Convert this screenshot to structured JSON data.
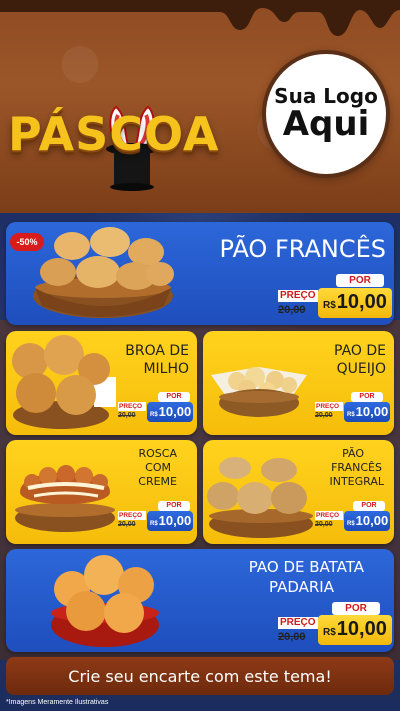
{
  "header": {
    "title": "PÁSCOA",
    "logo_line1": "Sua Logo",
    "logo_line2": "Aqui"
  },
  "products": [
    {
      "name": "PÃO FRANCÊS",
      "discount": "-50%",
      "price_label": "PREÇO",
      "old_price": "20,00",
      "por_label": "POR",
      "currency": "R$",
      "new_price": "10,00"
    },
    {
      "name_line1": "BROA DE",
      "name_line2": "MILHO",
      "price_label": "PREÇO",
      "old_price": "20,00",
      "por_label": "POR",
      "currency": "R$",
      "new_price": "10,00"
    },
    {
      "name_line1": "PAO DE",
      "name_line2": "QUEIJO",
      "price_label": "PREÇO",
      "old_price": "20,00",
      "por_label": "POR",
      "currency": "R$",
      "new_price": "10,00"
    },
    {
      "name_line1": "ROSCA",
      "name_line2": "COM",
      "name_line3": "CREME",
      "price_label": "PREÇO",
      "old_price": "20,00",
      "por_label": "POR",
      "currency": "R$",
      "new_price": "10,00"
    },
    {
      "name_line1": "PÃO",
      "name_line2": "FRANCÊS",
      "name_line3": "INTEGRAL",
      "price_label": "PREÇO",
      "old_price": "20,00",
      "por_label": "POR",
      "currency": "R$",
      "new_price": "10,00"
    },
    {
      "name_line1": "PAO DE BATATA",
      "name_line2": "PADARIA",
      "price_label": "PREÇO",
      "old_price": "20,00",
      "por_label": "POR",
      "currency": "R$",
      "new_price": "10,00"
    }
  ],
  "cta": "Crie seu encarte com este tema!",
  "disclaimer": "*Imagens Meramente Ilustrativas",
  "colors": {
    "brown": "#8f4b22",
    "navy": "#1d2f64",
    "blue": "#2c67d9",
    "yellow": "#ffd21e",
    "red": "#d01a1a",
    "gold": "#f6c21c"
  }
}
